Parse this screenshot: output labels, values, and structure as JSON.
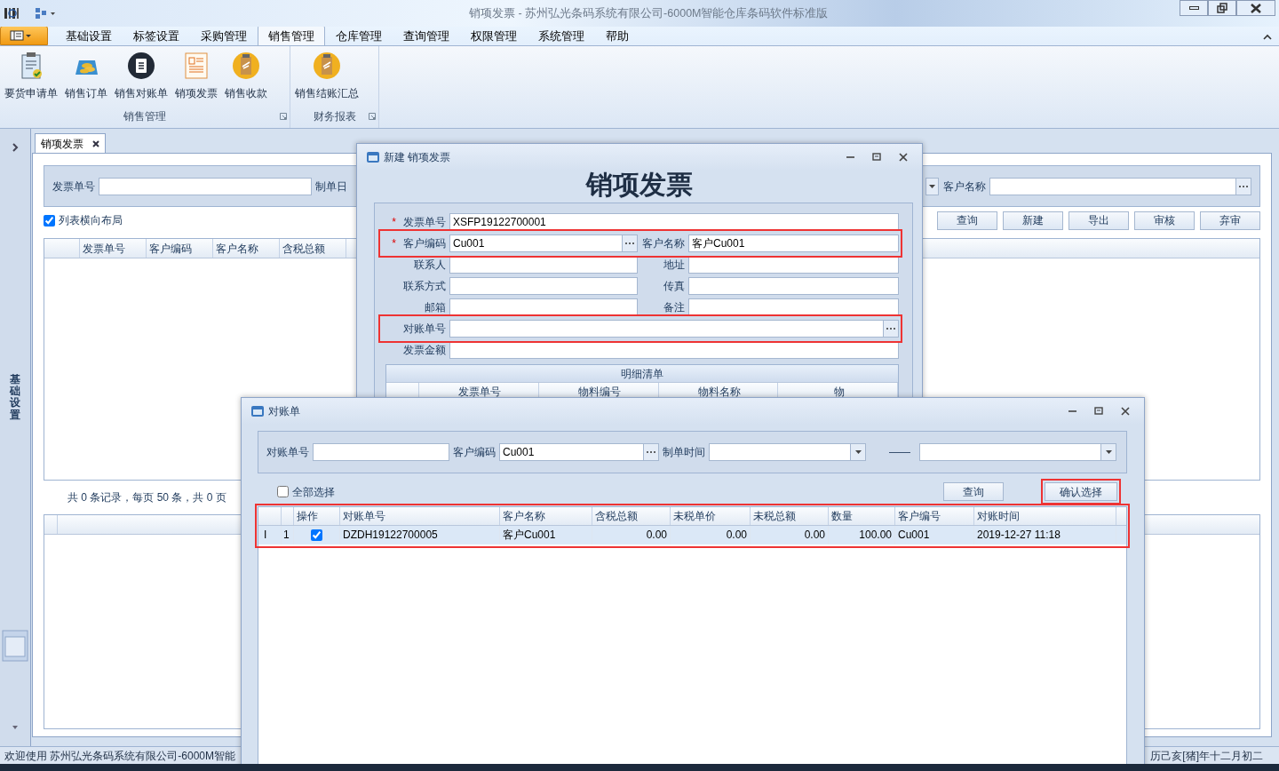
{
  "window": {
    "title": "销项发票 - 苏州弘光条码系统有限公司-6000M智能仓库条码软件标准版"
  },
  "ribbon_tabs": [
    {
      "label": "基础设置",
      "selected": false
    },
    {
      "label": "标签设置",
      "selected": false
    },
    {
      "label": "采购管理",
      "selected": false
    },
    {
      "label": "销售管理",
      "selected": true
    },
    {
      "label": "仓库管理",
      "selected": false
    },
    {
      "label": "查询管理",
      "selected": false
    },
    {
      "label": "权限管理",
      "selected": false
    },
    {
      "label": "系统管理",
      "selected": false
    },
    {
      "label": "帮助",
      "selected": false
    }
  ],
  "ribbon_groups": [
    {
      "label": "销售管理",
      "buttons": [
        "要货申请单",
        "销售订单",
        "销售对账单",
        "销项发票",
        "销售收款"
      ]
    },
    {
      "label": "财务报表",
      "buttons": [
        "销售结账汇总"
      ]
    }
  ],
  "sidebar": {
    "label": "基础设置"
  },
  "document_tabs": [
    {
      "label": "销项发票",
      "selected": true
    }
  ],
  "filter": {
    "invoice_label": "发票单号",
    "date_label": "制单日",
    "customer_label": "客户名称"
  },
  "toolbar_buttons": [
    "查询",
    "新建",
    "导出",
    "审核",
    "弃审"
  ],
  "layout_checkbox": {
    "label": "列表横向布局",
    "checked": true
  },
  "list_columns": [
    "发票单号",
    "客户编码",
    "客户名称",
    "含税总额"
  ],
  "pager": "共 0 条记录，每页 50 条，共 0 页",
  "invoice_dialog": {
    "title": "新建 销项发票",
    "heading": "销项发票",
    "rows": [
      {
        "highlighted": false,
        "fields": [
          {
            "label": "发票单号",
            "value": "XSFP19122700001",
            "required_mark": "*",
            "lookup": false
          }
        ]
      },
      {
        "highlighted": true,
        "fields": [
          {
            "label": "客户编码",
            "value": "Cu001",
            "required_mark": "*",
            "lookup": true
          },
          {
            "label": "客户名称",
            "value": "客户Cu001",
            "lookup": false
          }
        ]
      },
      {
        "highlighted": false,
        "fields": [
          {
            "label": "联系人",
            "lookup": false
          },
          {
            "label": "地址",
            "lookup": false
          }
        ]
      },
      {
        "highlighted": false,
        "fields": [
          {
            "label": "联系方式",
            "lookup": false
          },
          {
            "label": "传真",
            "lookup": false
          }
        ]
      },
      {
        "highlighted": false,
        "fields": [
          {
            "label": "邮箱",
            "lookup": false
          },
          {
            "label": "备注",
            "lookup": false
          }
        ]
      },
      {
        "highlighted": true,
        "fields": [
          {
            "label": "对账单号",
            "lookup": true
          }
        ]
      },
      {
        "highlighted": false,
        "fields": [
          {
            "label": "发票金额",
            "lookup": false
          }
        ]
      }
    ],
    "detail": {
      "title": "明细清单",
      "columns": [
        "发票单号",
        "物料编号",
        "物料名称",
        "物"
      ]
    }
  },
  "statement_dialog": {
    "title": "对账单",
    "filter": {
      "statement_label": "对账单号",
      "customer_label": "客户编码",
      "customer_value": "Cu001",
      "date_label": "制单时间",
      "range_separator": "——"
    },
    "select_all": {
      "label": "全部选择",
      "checked": false
    },
    "buttons": [
      {
        "label": "查询",
        "highlighted": false
      },
      {
        "label": "确认选择",
        "highlighted": true
      }
    ],
    "grid": {
      "highlighted": true,
      "columns": [
        "",
        "",
        "操作",
        "对账单号",
        "客户名称",
        "含税总额",
        "未税单价",
        "未税总额",
        "数量",
        "客户编号",
        "对账时间"
      ],
      "rows": [
        {
          "checked": true,
          "selected": true,
          "cells": [
            "I",
            "1",
            "",
            "DZDH19122700005",
            "客户Cu001",
            "0.00",
            "0.00",
            "0.00",
            "100.00",
            "Cu001",
            "2019-12-27 11:18"
          ]
        }
      ]
    }
  },
  "status_bar": {
    "left": "欢迎使用 苏州弘光条码系统有限公司-6000M智能",
    "right": "历己亥[猪]年十二月初二"
  }
}
